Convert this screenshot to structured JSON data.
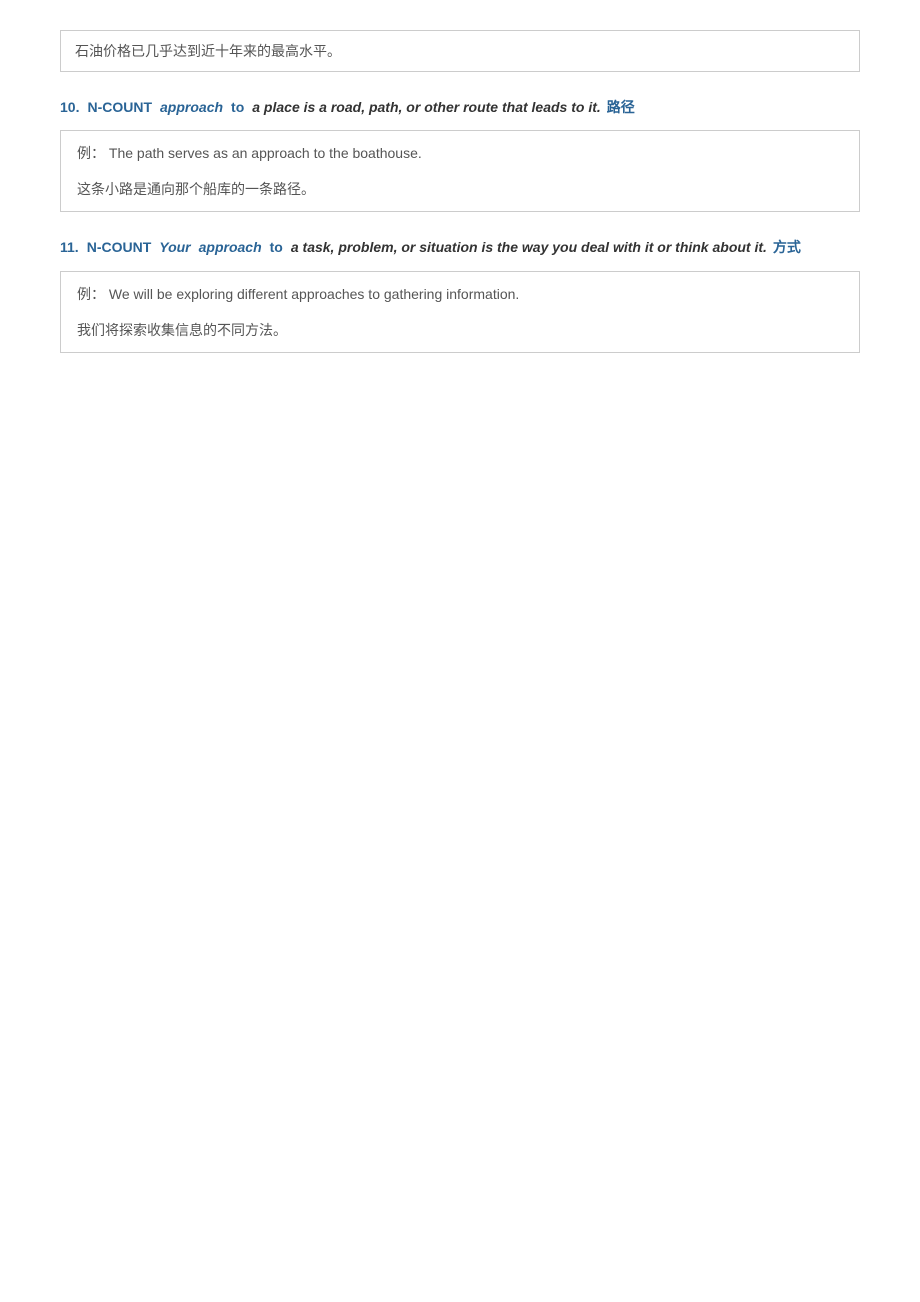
{
  "top_example": {
    "text": "石油价格已几乎达到近十年来的最高水平。"
  },
  "entry10": {
    "number": "10.",
    "pos": "N-COUNT",
    "keyword": "approach",
    "preposition": "to",
    "definition": "a place is a road, path, or other route that leads to it.",
    "translation": "路径",
    "example_en_prefix": "例：",
    "example_en": "The path serves as an approach to the boathouse.",
    "example_cn": "这条小路是通向那个船库的一条路径。"
  },
  "entry11": {
    "number": "11.",
    "pos": "N-COUNT",
    "keyword": "Your",
    "keyword2": "approach",
    "preposition": "to",
    "definition": "a task, problem, or situation is the way you deal with it or think about it.",
    "translation": "方式",
    "continuation": "it.",
    "example_en_prefix": "例：",
    "example_en": "We will be exploring different approaches to gathering information.",
    "example_cn": "我们将探索收集信息的不同方法。"
  }
}
